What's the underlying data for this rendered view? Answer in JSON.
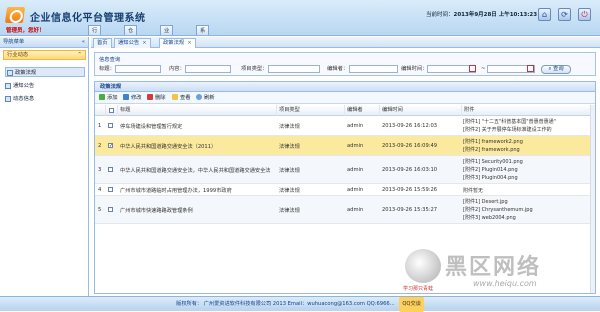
{
  "header": {
    "app_title": "企业信息化平台管理系统",
    "welcome": "管理员，您好！",
    "time_label": "当前时间：",
    "time_value": "2013年9月28日 上午10:13:23"
  },
  "main_tabs": [
    "行业动态",
    "仓库管理",
    "业务报表",
    "系统管理"
  ],
  "sidebar": {
    "title": "导航菜单",
    "collapse_label": "«",
    "group": "行业动态",
    "items": [
      "政策法规",
      "通知公告",
      "动态信息"
    ]
  },
  "content_tabs": [
    {
      "label": "首页"
    },
    {
      "label": "通知公告"
    },
    {
      "label": "政策法规"
    }
  ],
  "query": {
    "legend": "信息查询",
    "fields": [
      "标题：",
      "内容：",
      "项目类型：",
      "编辑者：",
      "编辑时间："
    ],
    "range_sep": "~",
    "button": "查询"
  },
  "panel": {
    "title": "政策法规",
    "toolbar": [
      "添加",
      "修改",
      "删除",
      "查看",
      "刷新"
    ],
    "columns": [
      "",
      "",
      "标题",
      "项目类型",
      "编辑者",
      "编辑时间",
      "附件"
    ],
    "rows": [
      {
        "no": "1",
        "checked": false,
        "title": "停车场建设和管理暂行规定",
        "type": "法律法规",
        "editor": "admin",
        "time": "2013-09-26 16:12:03",
        "attachments": [
          "[附件1] \"十二五\"科普基本国\"普惠普惠通\"",
          "[附件2] 关于开展停车场标准建设工作的"
        ]
      },
      {
        "no": "2",
        "checked": true,
        "title": "中华人民共和国道路交通安全法（2011）",
        "type": "法律法规",
        "editor": "admin",
        "time": "2013-09-26 16:09:49",
        "attachments": [
          "[附件1] framework2.png",
          "[附件2] framework.png"
        ]
      },
      {
        "no": "3",
        "checked": false,
        "title": "中华人民共和国道路交通安全法，中华人民共和国道路交通安全法",
        "type": "法律法规",
        "editor": "admin",
        "time": "2013-09-26 16:03:10",
        "attachments": [
          "[附件1] Security001.png",
          "[附件2] Plugin014.png",
          "[附件3] Plugin004.png"
        ]
      },
      {
        "no": "4",
        "checked": false,
        "title": "广州市城市道路临时占用管理办法，1999市政府",
        "type": "法律法规",
        "editor": "admin",
        "time": "2013-09-26 15:59:26",
        "attachments": [
          "附件暂无"
        ]
      },
      {
        "no": "5",
        "checked": false,
        "title": "广州市城市快速路路政管理条例",
        "type": "法律法规",
        "editor": "admin",
        "time": "2013-09-26 15:35:27",
        "attachments": [
          "[附件1] Desert.jpg",
          "[附件2] Chrysanthemum.jpg",
          "[附件3] web2004.png"
        ]
      }
    ]
  },
  "footer": {
    "text": "版权所有：  广州爱资进软件科技有限公司 2013 Email：wuhuacong@163.com QQ:6966...",
    "qq_label": "QQ交谈"
  },
  "watermark": {
    "text": "黑区网络",
    "url": "www.heiqu.com",
    "sub": "学习那只青蛙"
  },
  "colors": {
    "accent": "#15428b",
    "selected_row": "#fbe99e",
    "header_bg": "#c9e0f6"
  }
}
